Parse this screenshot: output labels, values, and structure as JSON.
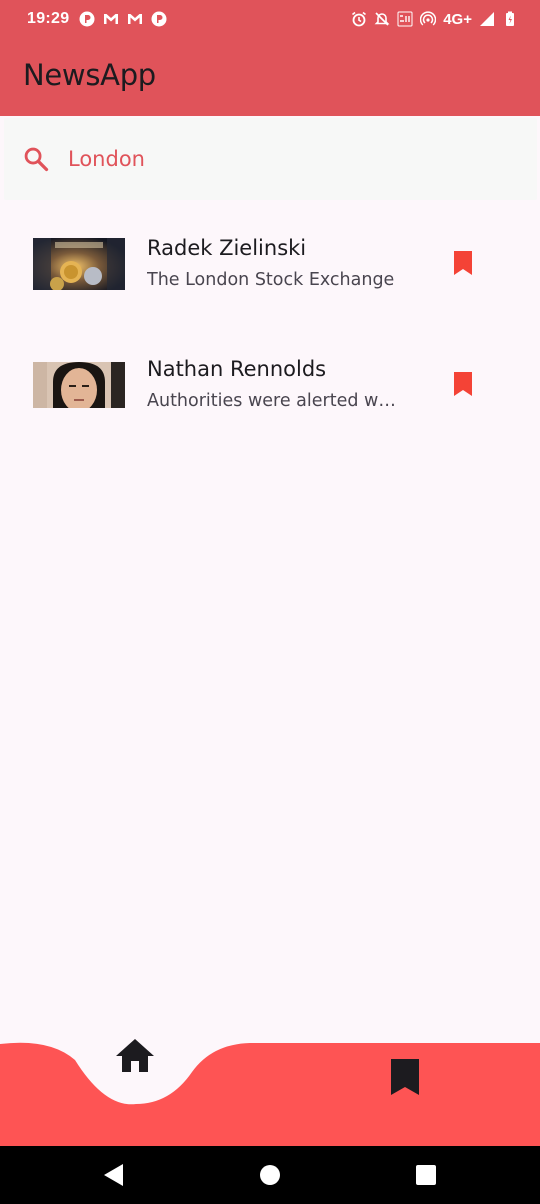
{
  "status_bar": {
    "time": "19:29",
    "network": "4G+"
  },
  "app_bar": {
    "title": "NewsApp"
  },
  "search": {
    "query": "London",
    "icon": "search-icon"
  },
  "news": [
    {
      "title": "Radek Zielinski",
      "subtitle": "The London Stock Exchange",
      "bookmarked": true
    },
    {
      "title": "Nathan Rennolds",
      "subtitle": "Authorities were alerted when",
      "bookmarked": true
    }
  ],
  "bottom_nav": {
    "items": [
      {
        "icon": "home-icon",
        "selected": true
      },
      {
        "icon": "bookmark-icon",
        "selected": false
      }
    ]
  },
  "colors": {
    "primary": "#e0535a",
    "nav_red": "#fe5454",
    "accent": "#f44336",
    "background": "#fdf7fb"
  }
}
